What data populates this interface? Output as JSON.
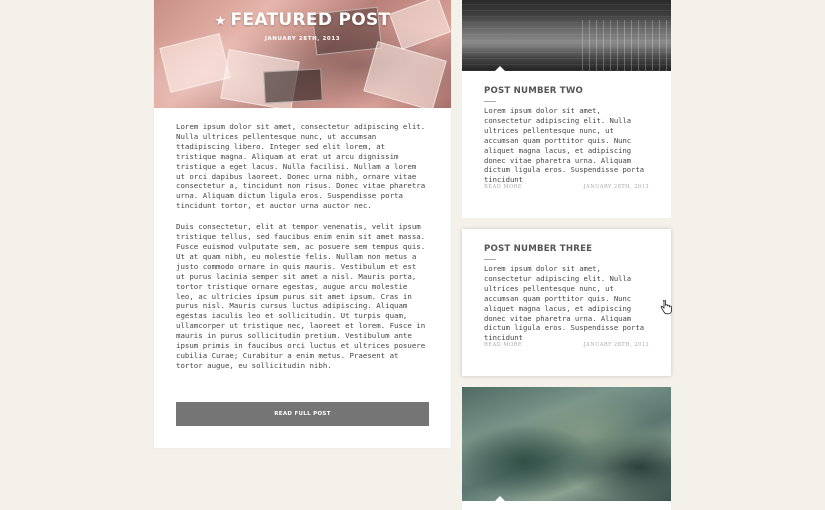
{
  "featured": {
    "title": "FEATURED POST",
    "date": "JANUARY 28TH, 2013",
    "paragraphs": [
      "Lorem ipsum dolor sit amet, consectetur adipiscing elit. Nulla ultrices pellentesque nunc, ut accumsan ttadipiscing libero. Integer sed elit lorem, at tristique magna. Aliquam at erat ut arcu dignissim tristique a eget lacus. Nulla facilisi. Nullam a lorem ut orci dapibus laoreet. Donec urna nibh, ornare vitae consectetur a, tincidunt non risus. Donec vitae pharetra urna. Aliquam dictum ligula eros. Suspendisse porta tincidunt tortor, et auctor urna auctor nec.",
      "Duis consectetur, elit at tempor venenatis, velit ipsum tristique tellus, sed faucibus enim enim sit amet massa. Fusce euismod vulputate sem, ac posuere sem tempus quis. Ut at quam nibh, eu molestie felis. Nullam non metus a justo commodo ornare in quis mauris. Vestibulum et est ut purus lacinia semper sit amet a nisl. Mauris porta, tortor tristique ornare egestas, augue arcu molestie leo, ac ultricies ipsum purus sit amet ipsum. Cras in purus nisl. Mauris cursus luctus adipiscing. Aliquam egestas iaculis leo et sollicitudin. Ut turpis quam, ullamcorper ut tristique nec, laoreet et lorem. Fusce in mauris in purus sollicitudin pretium. Vestibulum ante ipsum primis in faucibus orci luctus et ultrices posuere cubilia Curae; Curabitur a enim metus. Praesent at tortor augue, eu sollicitudin nibh."
    ],
    "read_button": "READ FULL POST"
  },
  "posts": [
    {
      "title": "POST NUMBER TWO",
      "excerpt": "Lorem ipsum dolor sit amet, consectetur adipiscing elit. Nulla ultrices pellentesque nunc, ut accumsan quam porttitor quis. Nunc aliquet magna lacus, et adipiscing donec vitae pharetra urna. Aliquam dictum ligula eros. Suspendisse porta tincidunt",
      "read_more": "READ MORE",
      "date": "JANUARY 28TH, 2013"
    },
    {
      "title": "POST NUMBER THREE",
      "excerpt": "Lorem ipsum dolor sit amet, consectetur adipiscing elit. Nulla ultrices pellentesque nunc, ut accumsan quam porttitor quis. Nunc aliquet magna lacus, et adipiscing donec vitae pharetra urna. Aliquam dictum ligula eros. Suspendisse porta tincidunt",
      "read_more": "READ MORE",
      "date": "JANUARY 28TH, 2013"
    }
  ],
  "icons": {
    "star": "star-icon",
    "cursor": "hand-pointer-icon"
  }
}
